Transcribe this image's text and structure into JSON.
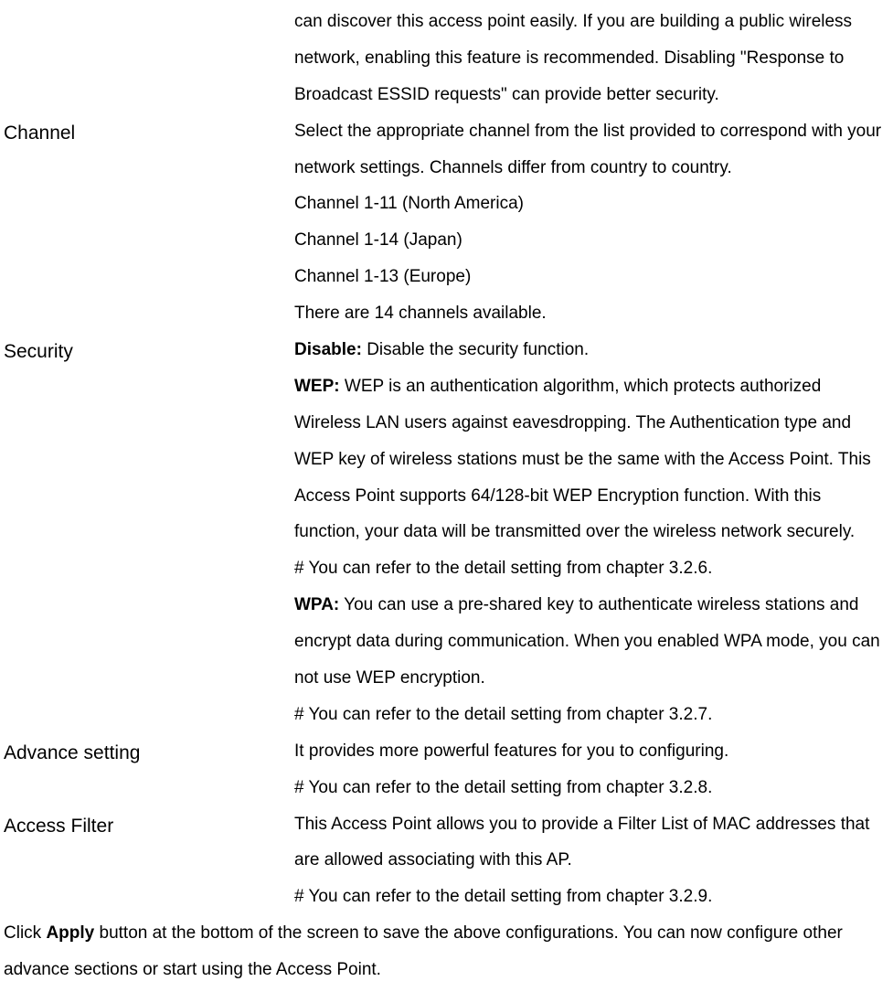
{
  "sections": [
    {
      "label": "",
      "content": "can discover this access point easily. If you are building a public wireless network, enabling this feature is recommended. Disabling \"Response to Broadcast ESSID requests\" can provide better security."
    },
    {
      "label": "Channel",
      "content": "Select the appropriate channel from the list provided to correspond with your network settings. Channels differ from country to country.\nChannel 1-11 (North America)\nChannel 1-14 (Japan)\nChannel 1-13 (Europe)\nThere are 14 channels available."
    },
    {
      "label": "Security",
      "boldparts": [
        {
          "bold": "Disable:",
          "text": " Disable the security function."
        },
        {
          "bold": "WEP:",
          "text": " WEP is an authentication algorithm, which protects authorized Wireless LAN users against eavesdropping. The Authentication type and WEP key of wireless stations must be the same with the Access Point. This Access Point supports 64/128-bit WEP Encryption function. With this function, your data will be transmitted over the wireless network securely.\n# You can refer to the detail setting from chapter 3.2.6."
        },
        {
          "bold": "WPA:",
          "text": " You can use a pre-shared key to authenticate wireless stations and encrypt data during communication. When you enabled WPA mode, you can not use WEP encryption.\n# You can refer to the detail setting from chapter 3.2.7."
        }
      ]
    },
    {
      "label": "Advance setting",
      "content": "It provides more powerful features for you to configuring.\n# You can refer to the detail setting from chapter 3.2.8."
    },
    {
      "label": "Access Filter",
      "content": "This Access Point allows you to provide a Filter List of MAC addresses that are allowed associating with this AP.\n# You can refer to the detail setting from chapter 3.2.9."
    }
  ],
  "footer": {
    "pre": "Click ",
    "bold": "Apply",
    "post": " button at the bottom of the screen to save the above configurations. You can now configure other advance sections or start using the Access Point."
  }
}
